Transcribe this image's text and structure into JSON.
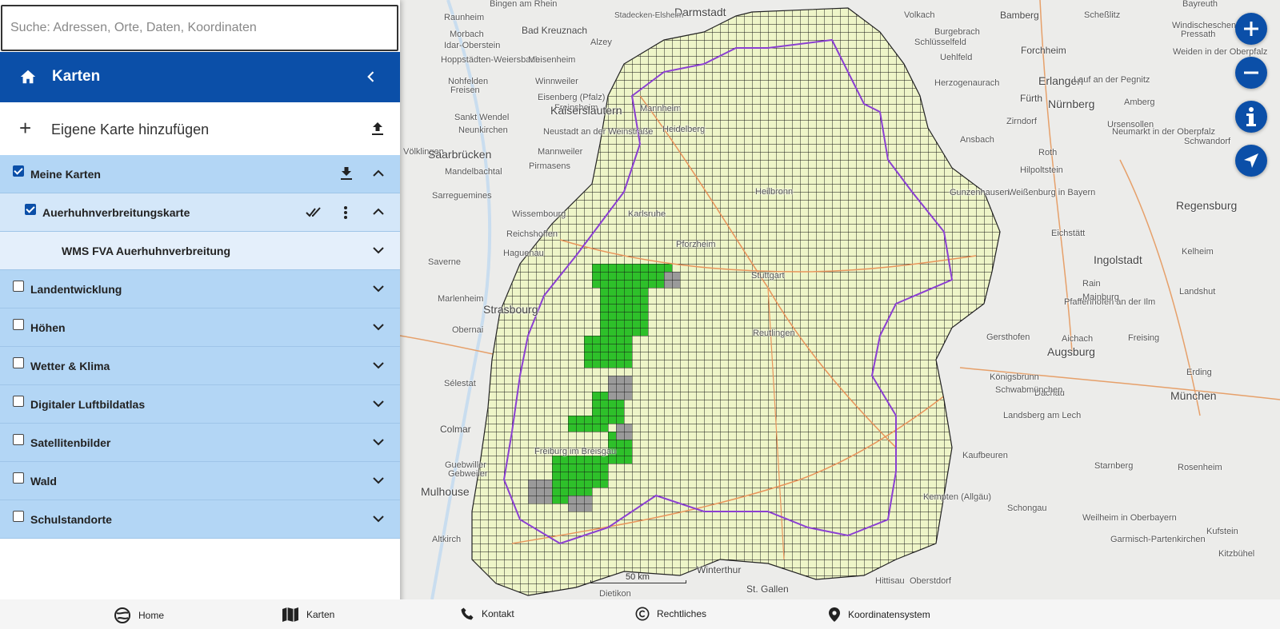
{
  "search": {
    "placeholder": "Suche: Adressen, Orte, Daten, Koordinaten"
  },
  "panel": {
    "title": "Karten",
    "add_map_label": "Eigene Karte hinzufügen"
  },
  "layers": [
    {
      "label": "Meine Karten",
      "checked": true
    },
    {
      "label": "Auerhuhnverbreitungskarte",
      "checked": true
    },
    {
      "label": "WMS FVA Auerhuhnverbreitung"
    },
    {
      "label": "Landentwicklung",
      "checked": false
    },
    {
      "label": "Höhen",
      "checked": false
    },
    {
      "label": "Wetter & Klima",
      "checked": false
    },
    {
      "label": "Digitaler Luftbildatlas",
      "checked": false
    },
    {
      "label": "Satellitenbilder",
      "checked": false
    },
    {
      "label": "Wald",
      "checked": false
    },
    {
      "label": "Schulstandorte",
      "checked": false
    }
  ],
  "map": {
    "scale_label": "50 km",
    "places": [
      "Darmstadt",
      "Bamberg",
      "Bayreuth",
      "Bingen am Rhein",
      "Stadecken-Elsheim",
      "Volkach",
      "Scheßlitz",
      "Raunheim",
      "Bad Kreuznach",
      "Burgebrach",
      "Windischeschenbach",
      "Morbach",
      "Alzey",
      "Schlüsselfeld",
      "Pressath",
      "Idar-Oberstein",
      "Forchheim",
      "Weiden in der Oberpfalz",
      "Hoppstädten-Weiersbach",
      "Meisenheim",
      "Uehlfeld",
      "Nohfelden",
      "Winnweiler",
      "Herzogenaurach",
      "Erlangen",
      "Freisen",
      "Eisenberg (Pfalz)",
      "Lauf an der Pegnitz",
      "Mannheim",
      "Fürth",
      "Nürnberg",
      "Amberg",
      "Sankt Wendel",
      "Freinsheim",
      "Neunkirchen",
      "Heidelberg",
      "Zirndorf",
      "Kaiserslautern",
      "Neustadt an der Weinstraße",
      "Ursensollen",
      "Neumarkt in der Oberpfalz",
      "Völklingen",
      "Saarbrücken",
      "Mannweiler",
      "Schwandorf",
      "Roth",
      "Ansbach",
      "Mandelbachtal",
      "Pirmasens",
      "Heilbronn",
      "Hilpoltstein",
      "Weißenburg in Bayern",
      "Sarreguemines",
      "Gunzenhausen",
      "Regensburg",
      "Karlsruhe",
      "Wissembourg",
      "Eichstätt",
      "Reichshoffen",
      "Pforzheim",
      "Haguenau",
      "Ingolstadt",
      "Kelheim",
      "Saverne",
      "Stuttgart",
      "Marlenheim",
      "Strasbourg",
      "Rain",
      "Landshut",
      "Pfaffenhofen an der Ilm",
      "Reutlingen",
      "Mainburg",
      "Obernai",
      "Augsburg",
      "Gersthofen",
      "Aichach",
      "Freising",
      "Erding",
      "Sélestat",
      "Königsbrunn",
      "Dachau",
      "München",
      "Colmar",
      "Schwabmünchen",
      "Landsberg am Lech",
      "Freiburg im Breisgau",
      "Kaufbeuren",
      "Starnberg",
      "Rosenheim",
      "Mulhouse",
      "Altkirch",
      "Schongau",
      "Weilheim in Oberbayern",
      "Kempten (Allgäu)",
      "Garmisch-Partenkirchen",
      "Winterthur",
      "Dietikon",
      "St. Gallen",
      "Hittisau",
      "Oberstdorf",
      "Kufstein",
      "Kitzbühel",
      "Gebweiler",
      "Guebwiller"
    ]
  },
  "controls": [
    "zoom-in",
    "zoom-out",
    "info",
    "locate"
  ],
  "bottom_nav": [
    {
      "label": "Home",
      "icon": "globe-icon"
    },
    {
      "label": "Karten",
      "icon": "map-icon"
    },
    {
      "label": "Kontakt",
      "icon": "phone-icon"
    },
    {
      "label": "Rechtliches",
      "icon": "copyright-icon"
    },
    {
      "label": "Koordinatensystem",
      "icon": "pin-icon"
    }
  ]
}
